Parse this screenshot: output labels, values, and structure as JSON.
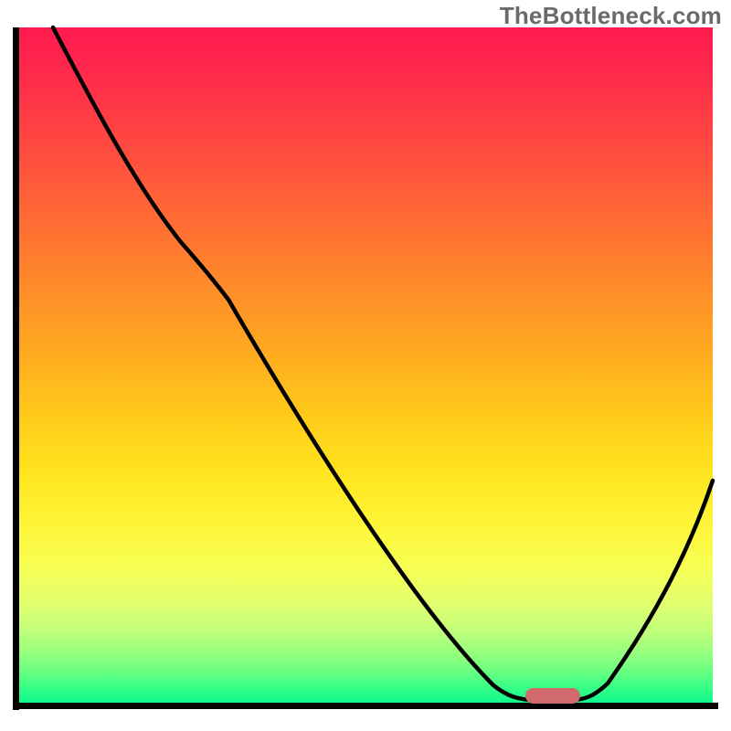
{
  "watermark": "TheBottleneck.com",
  "chart_data": {
    "type": "line",
    "title": "",
    "xlabel": "",
    "ylabel": "",
    "xlim": [
      0,
      100
    ],
    "ylim": [
      0,
      100
    ],
    "grid": false,
    "legend": false,
    "background": "rainbow-vertical-gradient (red top → green bottom)",
    "series": [
      {
        "name": "bottleneck-curve",
        "color": "#000000",
        "x": [
          5,
          12,
          18,
          24,
          30,
          40,
          50,
          58,
          66,
          72,
          78,
          82,
          88,
          94,
          100
        ],
        "y": [
          100,
          88,
          76,
          68,
          60,
          46,
          28,
          14,
          4,
          0.5,
          0.5,
          2,
          10,
          22,
          33
        ]
      }
    ],
    "annotations": [
      {
        "name": "optimal-marker",
        "shape": "pill",
        "color": "#d16a6e",
        "x": 77,
        "y": 1.5
      }
    ],
    "gradient_stops": [
      {
        "pos": 0.0,
        "color": "#ff1a4f"
      },
      {
        "pos": 0.28,
        "color": "#ff6a35"
      },
      {
        "pos": 0.58,
        "color": "#ffcc1a"
      },
      {
        "pos": 0.8,
        "color": "#f6ff55"
      },
      {
        "pos": 1.0,
        "color": "#0df98c"
      }
    ]
  }
}
